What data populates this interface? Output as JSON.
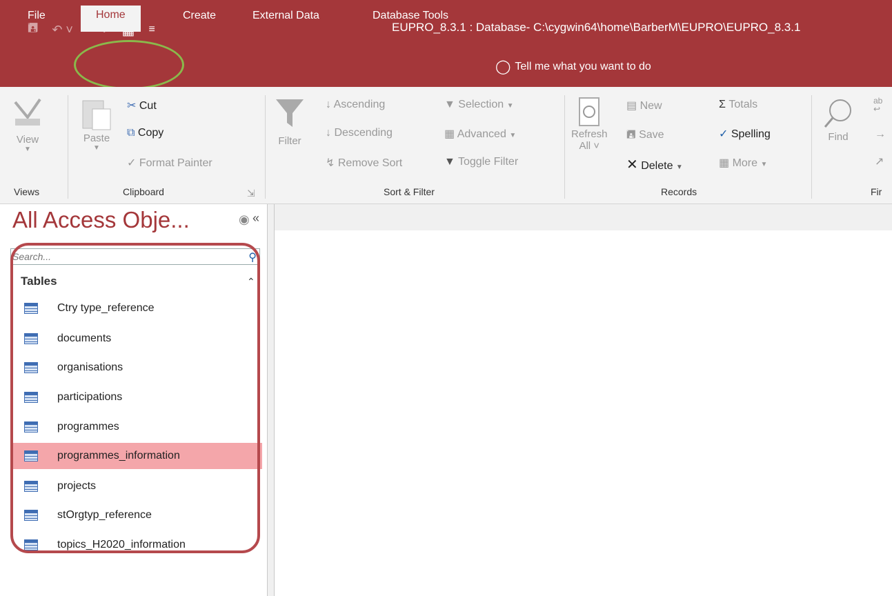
{
  "window": {
    "title": "EUPRO_8.3.1 : Database- C:\\cygwin64\\home\\BarberM\\EUPRO\\EUPRO_8.3.1"
  },
  "qat": {
    "items": [
      "save-icon",
      "undo-icon",
      "redo-icon",
      "form-view-icon",
      "customize-arrow-icon"
    ]
  },
  "tabs": [
    "File",
    "Home",
    "Create",
    "External Data",
    "Database Tools"
  ],
  "tell_me": "Tell me what you want to do",
  "ribbon": {
    "views": {
      "view": "View",
      "group": "Views"
    },
    "clipboard": {
      "cut": "Cut",
      "copy": "Copy",
      "paste": "Paste",
      "format_painter": "Format Painter",
      "group": "Clipboard"
    },
    "sort_filter": {
      "filter": "Filter",
      "ascending": "Ascending",
      "descending": "Descending",
      "remove_sort": "Remove Sort",
      "selection": "Selection",
      "advanced": "Advanced",
      "toggle_filter": "Toggle Filter",
      "group": "Sort & Filter"
    },
    "records": {
      "refresh": "Refresh",
      "all": "All",
      "new": "New",
      "save": "Save",
      "delete": "Delete",
      "totals": "Totals",
      "spelling": "Spelling",
      "more": "More",
      "group": "Records"
    },
    "find": {
      "find": "Find",
      "group": "Fir"
    }
  },
  "nav": {
    "title": "All Access Obje...",
    "search_placeholder": "Search...",
    "section": "Tables",
    "tables": [
      "Ctry type_reference",
      "documents",
      "organisations",
      "participations",
      "programmes",
      "programmes_information",
      "projects",
      "stOrgtyp_reference",
      "topics_H2020_information"
    ],
    "selected": "programmes_information"
  },
  "colors": {
    "accent": "#a4373a",
    "selection": "#f4a6aa",
    "annotation_green": "#8ab94b",
    "annotation_red": "#b5494d"
  }
}
